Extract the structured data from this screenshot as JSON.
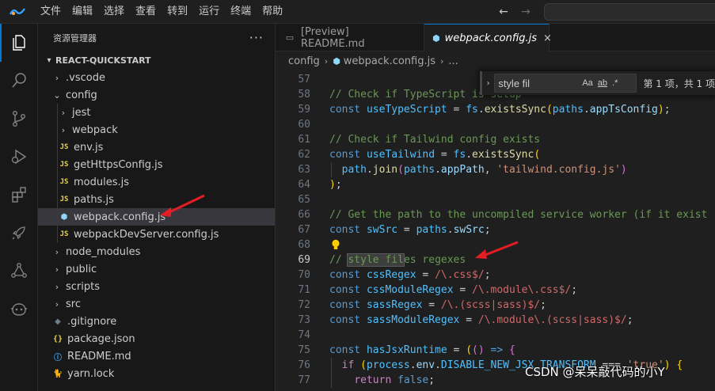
{
  "menu": [
    "文件",
    "编辑",
    "选择",
    "查看",
    "转到",
    "运行",
    "终端",
    "帮助"
  ],
  "colors": {
    "accent": "#0078d4",
    "editor_bg": "#1f1f1f",
    "sidebar_bg": "#181818",
    "annotation_arrow": "#e51c23"
  },
  "activity_icons": [
    "explorer-icon",
    "search-icon",
    "source-control-icon",
    "run-debug-icon",
    "extensions-icon",
    "rocket-icon",
    "tree-icon",
    "copilot-icon"
  ],
  "sidebar": {
    "title": "资源管理器",
    "more": "···",
    "project": "REACT-QUICKSTART",
    "items": [
      {
        "label": ".vscode",
        "kind": "folder",
        "icon": "chevron-right-icon"
      },
      {
        "label": "config",
        "kind": "folder-open",
        "icon": "chevron-down-icon"
      },
      {
        "label": "jest",
        "kind": "folder",
        "icon": "chevron-right-icon"
      },
      {
        "label": "webpack",
        "kind": "folder",
        "icon": "chevron-right-icon"
      },
      {
        "label": "env.js",
        "kind": "js",
        "icon": "js-file-icon",
        "glyph": "JS"
      },
      {
        "label": "getHttpsConfig.js",
        "kind": "js",
        "icon": "js-file-icon",
        "glyph": "JS"
      },
      {
        "label": "modules.js",
        "kind": "js",
        "icon": "js-file-icon",
        "glyph": "JS"
      },
      {
        "label": "paths.js",
        "kind": "js",
        "icon": "js-file-icon",
        "glyph": "JS"
      },
      {
        "label": "webpack.config.js",
        "kind": "webpack",
        "icon": "webpack-file-icon",
        "glyph": "⬢",
        "selected": true
      },
      {
        "label": "webpackDevServer.config.js",
        "kind": "js",
        "icon": "js-file-icon",
        "glyph": "JS"
      },
      {
        "label": "node_modules",
        "kind": "folder",
        "icon": "chevron-right-icon"
      },
      {
        "label": "public",
        "kind": "folder",
        "icon": "chevron-right-icon"
      },
      {
        "label": "scripts",
        "kind": "folder",
        "icon": "chevron-right-icon"
      },
      {
        "label": "src",
        "kind": "folder",
        "icon": "chevron-right-icon"
      },
      {
        "label": ".gitignore",
        "kind": "git",
        "icon": "git-file-icon",
        "glyph": "◆"
      },
      {
        "label": "package.json",
        "kind": "json",
        "icon": "json-file-icon",
        "glyph": "{}"
      },
      {
        "label": "README.md",
        "kind": "info",
        "icon": "info-file-icon",
        "glyph": "ⓘ"
      },
      {
        "label": "yarn.lock",
        "kind": "yarn",
        "icon": "yarn-file-icon",
        "glyph": "🐈"
      }
    ]
  },
  "tabs": [
    {
      "label": "[Preview] README.md",
      "active": false
    },
    {
      "label": "webpack.config.js",
      "active": true,
      "close": "×"
    }
  ],
  "breadcrumb": {
    "folder": "config",
    "file": "webpack.config.js",
    "more": "..."
  },
  "find": {
    "value": "style fil",
    "opt_case": "Aa",
    "opt_word": "ab",
    "opt_regex": ".*",
    "count": "第 1 项，共 1 项"
  },
  "code": [
    {
      "ln": "57",
      "tokens": []
    },
    {
      "ln": "58",
      "tokens": [
        [
          "cm",
          "// Check if TypeScript is setup"
        ]
      ]
    },
    {
      "ln": "59",
      "tokens": [
        [
          "kw",
          "const "
        ],
        [
          "var",
          "useTypeScript"
        ],
        [
          "punc",
          " = "
        ],
        [
          "var",
          "fs"
        ],
        [
          "punc",
          "."
        ],
        [
          "fn",
          "existsSync"
        ],
        [
          "br1",
          "("
        ],
        [
          "var",
          "paths"
        ],
        [
          "punc",
          "."
        ],
        [
          "prop",
          "appTsConfig"
        ],
        [
          "br1",
          ")"
        ],
        [
          "punc",
          ";"
        ]
      ]
    },
    {
      "ln": "60",
      "tokens": []
    },
    {
      "ln": "61",
      "tokens": [
        [
          "cm",
          "// Check if Tailwind config exists"
        ]
      ]
    },
    {
      "ln": "62",
      "tokens": [
        [
          "kw",
          "const "
        ],
        [
          "var",
          "useTailwind"
        ],
        [
          "punc",
          " = "
        ],
        [
          "var",
          "fs"
        ],
        [
          "punc",
          "."
        ],
        [
          "fn",
          "existsSync"
        ],
        [
          "br1",
          "("
        ]
      ]
    },
    {
      "ln": "63",
      "tokens": [
        [
          "punc",
          "  "
        ],
        [
          "var",
          "path"
        ],
        [
          "punc",
          "."
        ],
        [
          "fn",
          "join"
        ],
        [
          "br2",
          "("
        ],
        [
          "var",
          "paths"
        ],
        [
          "punc",
          "."
        ],
        [
          "prop",
          "appPath"
        ],
        [
          "punc",
          ", "
        ],
        [
          "str",
          "'tailwind.config.js'"
        ],
        [
          "br2",
          ")"
        ]
      ]
    },
    {
      "ln": "64",
      "tokens": [
        [
          "br1",
          ")"
        ],
        [
          "punc",
          ";"
        ]
      ]
    },
    {
      "ln": "65",
      "tokens": []
    },
    {
      "ln": "66",
      "tokens": [
        [
          "cm",
          "// Get the path to the uncompiled service worker (if it exist"
        ]
      ]
    },
    {
      "ln": "67",
      "tokens": [
        [
          "kw",
          "const "
        ],
        [
          "var",
          "swSrc"
        ],
        [
          "punc",
          " = "
        ],
        [
          "var",
          "paths"
        ],
        [
          "punc",
          "."
        ],
        [
          "prop",
          "swSrc"
        ],
        [
          "punc",
          ";"
        ]
      ]
    },
    {
      "ln": "68",
      "tokens": []
    },
    {
      "ln": "69",
      "tokens": [
        [
          "cm",
          "// "
        ],
        [
          "cm-hl",
          "style fil"
        ],
        [
          "cm",
          "es regexes"
        ]
      ],
      "current": true
    },
    {
      "ln": "70",
      "tokens": [
        [
          "kw",
          "const "
        ],
        [
          "var",
          "cssRegex"
        ],
        [
          "punc",
          " = "
        ],
        [
          "rx",
          "/\\.css$/"
        ],
        [
          "punc",
          ";"
        ]
      ]
    },
    {
      "ln": "71",
      "tokens": [
        [
          "kw",
          "const "
        ],
        [
          "var",
          "cssModuleRegex"
        ],
        [
          "punc",
          " = "
        ],
        [
          "rx",
          "/\\.module\\.css$/"
        ],
        [
          "punc",
          ";"
        ]
      ]
    },
    {
      "ln": "72",
      "tokens": [
        [
          "kw",
          "const "
        ],
        [
          "var",
          "sassRegex"
        ],
        [
          "punc",
          " = "
        ],
        [
          "rx",
          "/\\.(scss|sass)$/"
        ],
        [
          "punc",
          ";"
        ]
      ]
    },
    {
      "ln": "73",
      "tokens": [
        [
          "kw",
          "const "
        ],
        [
          "var",
          "sassModuleRegex"
        ],
        [
          "punc",
          " = "
        ],
        [
          "rx",
          "/\\.module\\.(scss|sass)$/"
        ],
        [
          "punc",
          ";"
        ]
      ]
    },
    {
      "ln": "74",
      "tokens": []
    },
    {
      "ln": "75",
      "tokens": [
        [
          "kw",
          "const "
        ],
        [
          "var",
          "hasJsxRuntime"
        ],
        [
          "punc",
          " = "
        ],
        [
          "br1",
          "("
        ],
        [
          "br2",
          "()"
        ],
        [
          "punc",
          " "
        ],
        [
          "kw",
          "=>"
        ],
        [
          "punc",
          " "
        ],
        [
          "br2",
          "{"
        ]
      ]
    },
    {
      "ln": "76",
      "tokens": [
        [
          "punc",
          "  "
        ],
        [
          "ctl",
          "if "
        ],
        [
          "br1",
          "("
        ],
        [
          "var",
          "process"
        ],
        [
          "punc",
          "."
        ],
        [
          "prop",
          "env"
        ],
        [
          "punc",
          "."
        ],
        [
          "var",
          "DISABLE_NEW_JSX_TRANSFORM"
        ],
        [
          "punc",
          " === "
        ],
        [
          "str",
          "'true'"
        ],
        [
          "br1",
          ")"
        ],
        [
          "punc",
          " "
        ],
        [
          "br1",
          "{"
        ]
      ]
    },
    {
      "ln": "77",
      "tokens": [
        [
          "punc",
          "    "
        ],
        [
          "ctl",
          "return "
        ],
        [
          "kw",
          "false"
        ],
        [
          "punc",
          ";"
        ]
      ]
    }
  ],
  "watermark": "CSDN @呆呆敲代码的小Y"
}
